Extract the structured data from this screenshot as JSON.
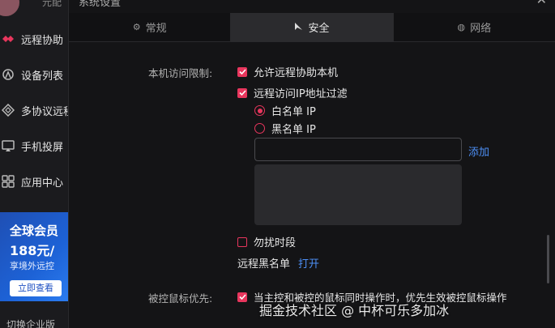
{
  "sidebar": {
    "username": "元配",
    "items": [
      {
        "label": "远程协助",
        "icon": "remote-assist-icon",
        "active": true
      },
      {
        "label": "设备列表",
        "icon": "device-list-icon"
      },
      {
        "label": "多协议远程",
        "icon": "multi-protocol-icon"
      },
      {
        "label": "手机投屏",
        "icon": "screen-cast-icon"
      },
      {
        "label": "应用中心",
        "icon": "app-center-icon"
      }
    ],
    "promo": {
      "title": "全球会员",
      "price": "188元/",
      "desc": "享境外远控",
      "button": "立即查看"
    },
    "switch_text": "切换企业版"
  },
  "dialog": {
    "title": "系统设置",
    "tabs": [
      {
        "label": "常规",
        "icon": "gear-icon"
      },
      {
        "label": "安全",
        "icon": "security-icon",
        "active": true
      },
      {
        "label": "网络",
        "icon": "globe-icon"
      }
    ],
    "access_limit_label": "本机访问限制:",
    "allow_remote_assist": "允许远程协助本机",
    "ip_filter": "远程访问IP地址过滤",
    "whitelist": "白名单 IP",
    "blacklist": "黑名单 IP",
    "ip_input_value": "",
    "add_link": "添加",
    "dnd": "勿扰时段",
    "remote_blacklist": "远程黑名单",
    "open_link": "打开",
    "mouse_priority_label": "被控鼠标优先:",
    "mouse_priority_option": "当主控和被控的鼠标同时操作时，优先生效被控鼠标操作"
  },
  "watermark": "掘金技术社区 @ 中杯可乐多加冰",
  "colors": {
    "accent": "#e8365d",
    "link": "#4d8ff5",
    "bg": "#141416"
  }
}
